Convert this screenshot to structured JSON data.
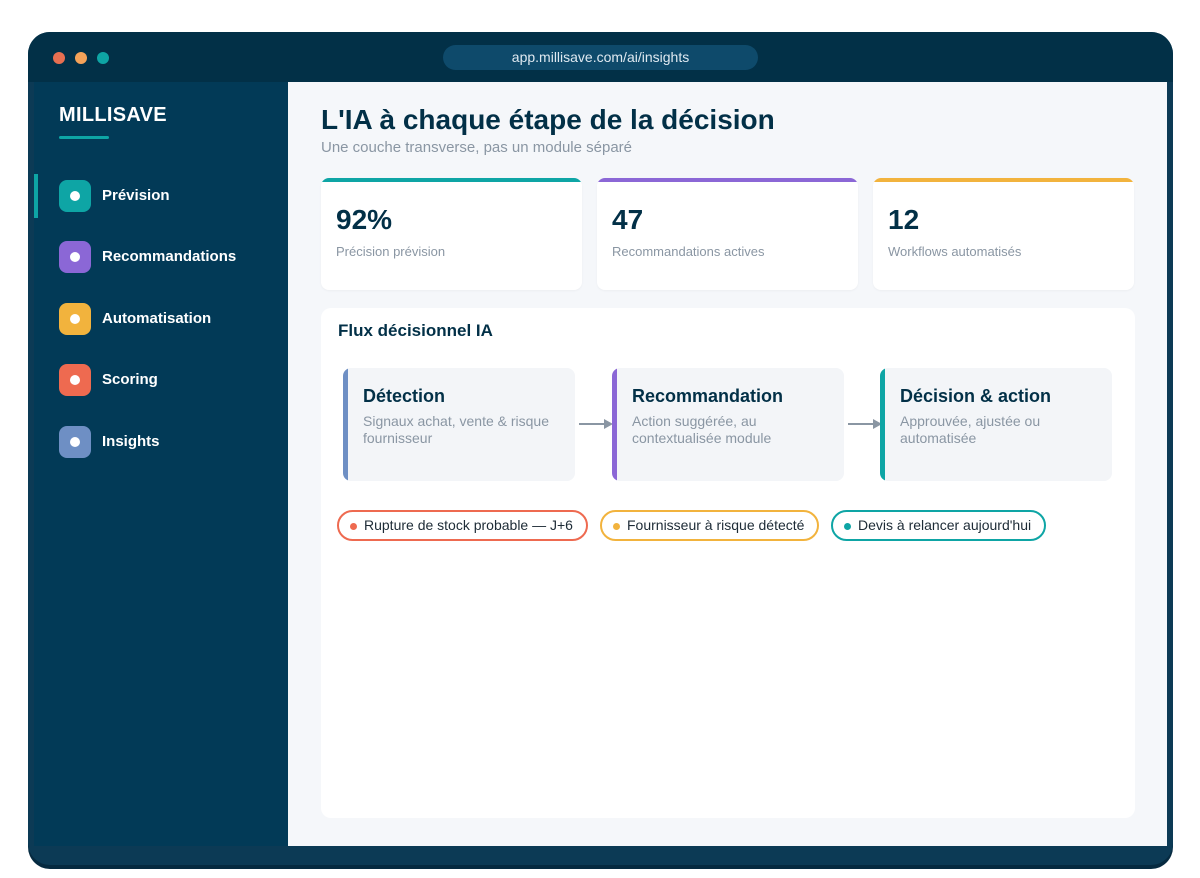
{
  "window": {
    "url": "app.millisave.com/ai/insights",
    "controls": [
      {
        "name": "close",
        "color": "#e76f51"
      },
      {
        "name": "minimize",
        "color": "#f4a259"
      },
      {
        "name": "maximize",
        "color": "#0ea5a5"
      }
    ]
  },
  "sidebar": {
    "brand": "MILLISAVE",
    "items": [
      {
        "label": "Prévision",
        "color": "#0ea5a5",
        "active": true
      },
      {
        "label": "Recommandations",
        "color": "#8b67d6",
        "active": false
      },
      {
        "label": "Automatisation",
        "color": "#f2b33d",
        "active": false
      },
      {
        "label": "Scoring",
        "color": "#ee6a50",
        "active": false
      },
      {
        "label": "Insights",
        "color": "#6e8fc4",
        "active": false
      }
    ]
  },
  "header": {
    "title": "L'IA à chaque étape de la décision",
    "subtitle": "Une couche transverse, pas un module séparé"
  },
  "kpis": [
    {
      "value": "92%",
      "label": "Précision prévision",
      "color": "#0ea5a5"
    },
    {
      "value": "47",
      "label": "Recommandations actives",
      "color": "#8b67d6"
    },
    {
      "value": "12",
      "label": "Workflows automatisés",
      "color": "#f2b33d"
    }
  ],
  "flow": {
    "title": "Flux décisionnel IA",
    "steps": [
      {
        "title": "Détection",
        "description": "Signaux achat, vente & risque fournisseur",
        "color": "#6e8fc4"
      },
      {
        "title": "Recommandation",
        "description": "Action suggérée, au contextualisée module",
        "color": "#8b67d6"
      },
      {
        "title": "Décision & action",
        "description": "Approuvée, ajustée ou automatisée",
        "color": "#0ea5a5"
      }
    ],
    "arrow_icon": "arrow-right-icon",
    "alerts": [
      {
        "text": "Rupture de stock probable — J+6",
        "color": "#ee6a50"
      },
      {
        "text": "Fournisseur à risque détecté",
        "color": "#f2b33d"
      },
      {
        "text": "Devis à relancer aujourd'hui",
        "color": "#0ea5a5"
      }
    ]
  }
}
